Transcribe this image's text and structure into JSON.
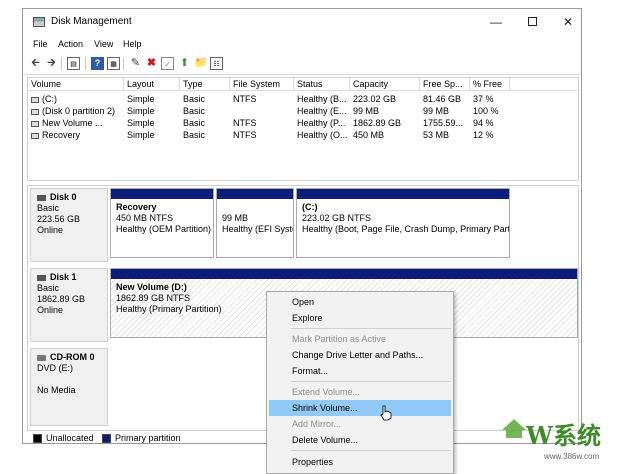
{
  "window": {
    "title": "Disk Management"
  },
  "menubar": [
    "File",
    "Action",
    "View",
    "Help"
  ],
  "toolbar_icons": [
    "back-arrow-icon",
    "forward-arrow-icon",
    "list-view-icon",
    "help-icon",
    "properties-icon",
    "edit-icon",
    "delete-icon",
    "check-icon",
    "refresh-icon",
    "explore-icon",
    "settings-icon"
  ],
  "volume_table": {
    "headers": [
      "Volume",
      "Layout",
      "Type",
      "File System",
      "Status",
      "Capacity",
      "Free Sp...",
      "% Free"
    ],
    "rows": [
      [
        "(C:)",
        "Simple",
        "Basic",
        "NTFS",
        "Healthy (B...",
        "223.02 GB",
        "81.46 GB",
        "37 %"
      ],
      [
        "(Disk 0 partition 2)",
        "Simple",
        "Basic",
        "",
        "Healthy (E...",
        "99 MB",
        "99 MB",
        "100 %"
      ],
      [
        "New Volume ...",
        "Simple",
        "Basic",
        "NTFS",
        "Healthy (P...",
        "1862.89 GB",
        "1755.59...",
        "94 %"
      ],
      [
        "Recovery",
        "Simple",
        "Basic",
        "NTFS",
        "Healthy (O...",
        "450 MB",
        "53 MB",
        "12 %"
      ]
    ]
  },
  "disks": [
    {
      "name": "Disk 0",
      "type": "Basic",
      "size": "223.56 GB",
      "status": "Online",
      "partitions": [
        {
          "title": "Recovery",
          "size": "450 MB NTFS",
          "status": "Healthy (OEM Partition)"
        },
        {
          "title": "",
          "size": "99 MB",
          "status": "Healthy (EFI Syste"
        },
        {
          "title": "(C:)",
          "size": "223.02 GB NTFS",
          "status": "Healthy (Boot, Page File, Crash Dump, Primary Partit"
        }
      ]
    },
    {
      "name": "Disk 1",
      "type": "Basic",
      "size": "1862.89 GB",
      "status": "Online",
      "partitions": [
        {
          "title": "New Volume  (D:)",
          "size": "1862.89 GB NTFS",
          "status": "Healthy (Primary Partition)"
        }
      ]
    },
    {
      "name": "CD-ROM 0",
      "type": "DVD (E:)",
      "size": "",
      "status": "No Media",
      "partitions": []
    }
  ],
  "legend": {
    "unallocated": "Unallocated",
    "primary": "Primary partition"
  },
  "context_menu": {
    "items": [
      {
        "label": "Open",
        "disabled": false
      },
      {
        "label": "Explore",
        "disabled": false
      },
      {
        "label": "Mark Partition as Active",
        "disabled": true
      },
      {
        "label": "Change Drive Letter and Paths...",
        "disabled": false
      },
      {
        "label": "Format...",
        "disabled": false
      },
      {
        "label": "Extend Volume...",
        "disabled": true
      },
      {
        "label": "Shrink Volume...",
        "disabled": false,
        "highlighted": true
      },
      {
        "label": "Add Mirror...",
        "disabled": true
      },
      {
        "label": "Delete Volume...",
        "disabled": false
      },
      {
        "label": "Properties",
        "disabled": false
      }
    ]
  },
  "colors": {
    "primary_partition": "#0c1c7a",
    "unallocated": "#000000",
    "highlight": "#91c9f7",
    "watermark": "#3f8b2a"
  },
  "watermark": {
    "logo_text": "W系统",
    "site": "www.386w.com"
  }
}
